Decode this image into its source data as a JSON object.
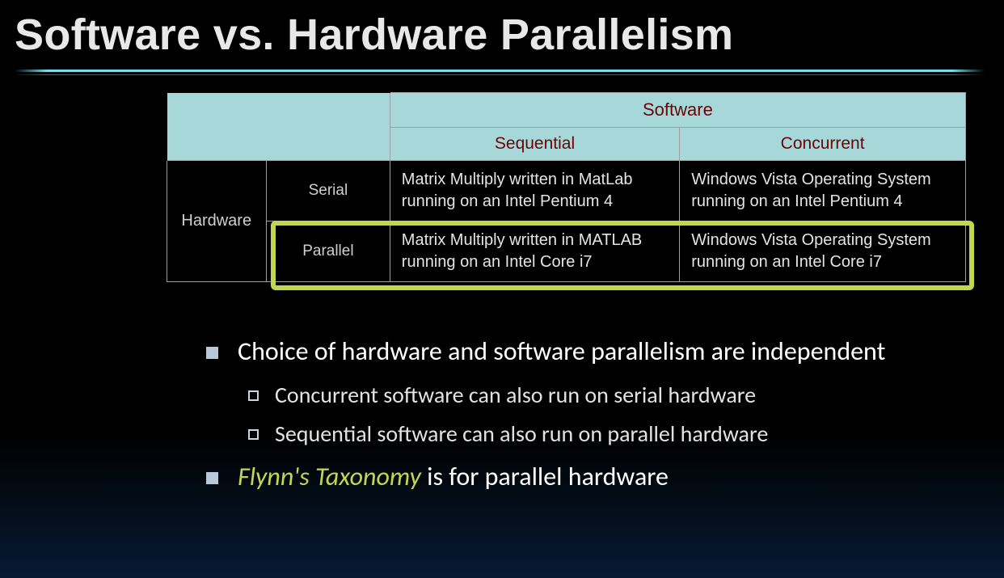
{
  "title": "Software vs. Hardware Parallelism",
  "table": {
    "top_header": "Software",
    "col_sequential": "Sequential",
    "col_concurrent": "Concurrent",
    "row_header": "Hardware",
    "sub_serial": "Serial",
    "sub_parallel": "Parallel",
    "cell_serial_seq": "Matrix Multiply written in MatLab running on an Intel Pentium 4",
    "cell_serial_conc": "Windows Vista Operating System running on an Intel Pentium 4",
    "cell_parallel_seq": "Matrix Multiply written in MATLAB running on an Intel Core i7",
    "cell_parallel_conc": "Windows Vista Operating System running on an Intel Core i7"
  },
  "bullets": {
    "b1": "Choice of hardware and software parallelism are independent",
    "b1a": "Concurrent software can also run on serial hardware",
    "b1b": "Sequential software can also run on parallel hardware",
    "b2_em": "Flynn's Taxonomy",
    "b2_rest": " is for parallel hardware"
  }
}
